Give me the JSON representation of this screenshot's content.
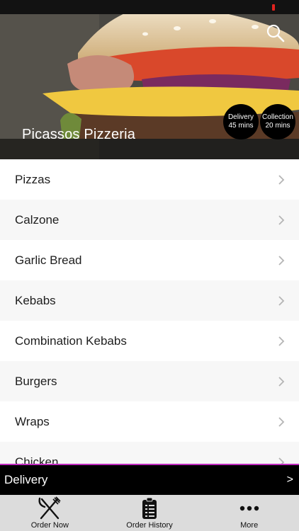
{
  "header": {
    "restaurant_name": "Picassos Pizzeria",
    "delivery": {
      "label": "Delivery",
      "time": "45 mins"
    },
    "collection": {
      "label": "Collection",
      "time": "20 mins"
    },
    "search_icon": "search-icon"
  },
  "menu": {
    "items": [
      {
        "label": "Pizzas"
      },
      {
        "label": "Calzone"
      },
      {
        "label": "Garlic Bread"
      },
      {
        "label": "Kebabs"
      },
      {
        "label": "Combination Kebabs"
      },
      {
        "label": "Burgers"
      },
      {
        "label": "Wraps"
      },
      {
        "label": "Chicken"
      }
    ]
  },
  "order_mode_bar": {
    "label": "Delivery",
    "arrow": ">"
  },
  "tabs": [
    {
      "label": "Order Now",
      "icon": "fork-knife-icon"
    },
    {
      "label": "Order History",
      "icon": "clipboard-list-icon"
    },
    {
      "label": "More",
      "icon": "more-dots-icon"
    }
  ],
  "colors": {
    "accent": "#c02ac0",
    "bar": "#000000",
    "tab_bar": "#dcdcdc"
  }
}
